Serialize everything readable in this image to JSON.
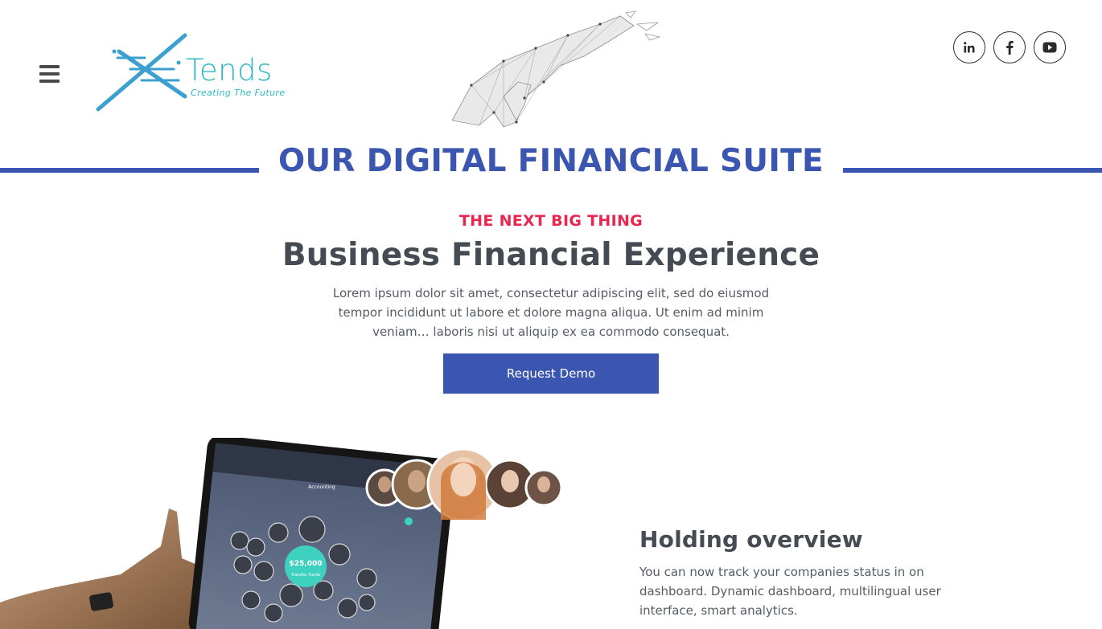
{
  "header": {
    "menu_icon": "hamburger-menu-icon",
    "logo": {
      "name": "Tends",
      "tagline": "Creating The Future"
    },
    "social": [
      {
        "label": "in",
        "icon": "linkedin-icon"
      },
      {
        "label": "f",
        "icon": "facebook-icon"
      },
      {
        "label": "youtube",
        "icon": "youtube-icon"
      }
    ]
  },
  "suite": {
    "title": "OUR DIGITAL FINANCIAL SUITE"
  },
  "hero": {
    "eyebrow": "THE NEXT BIG THING",
    "title": "Business Financial Experience",
    "text": "Lorem ipsum dolor sit amet, consectetur adipiscing elit, sed do eiusmod tempor incididunt ut labore et dolore magna aliqua. Ut enim ad minim veniam… laboris nisi ut aliquip ex ea commodo consequat.",
    "cta_label": "Request Demo"
  },
  "device": {
    "app_title": "Accounting",
    "amount": "$25,000",
    "amount_caption": "Transfer Funds"
  },
  "overview": {
    "title": "Holding overview",
    "text": "You can now track your companies status in on dashboard. Dynamic dashboard, multilingual user interface, smart analytics."
  },
  "colors": {
    "primary": "#3b56b0",
    "accent": "#e8264f",
    "logo": "#2eb8c6",
    "heading": "#454b52"
  }
}
